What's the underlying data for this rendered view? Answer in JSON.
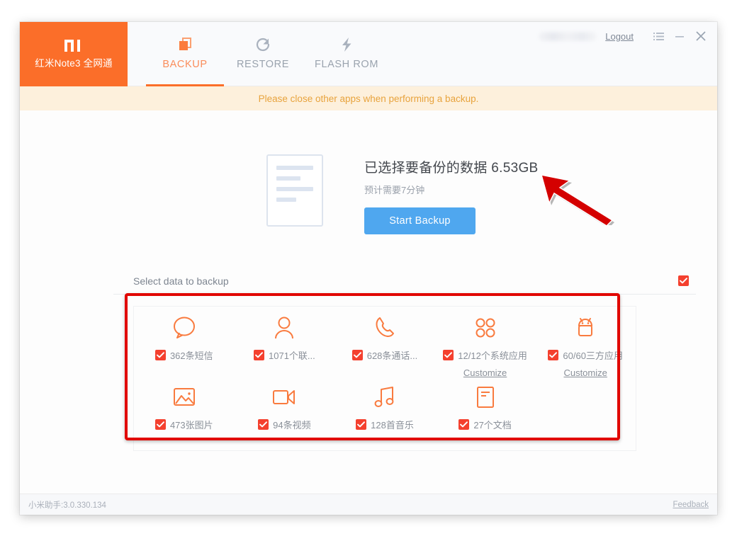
{
  "window": {
    "brand": {
      "logo_icon": "mi-logo-icon",
      "device_name": "红米Note3 全网通"
    },
    "tabs": [
      {
        "label": "BACKUP",
        "icon": "backup-icon",
        "active": true
      },
      {
        "label": "RESTORE",
        "icon": "restore-icon",
        "active": false
      },
      {
        "label": "FLASH ROM",
        "icon": "flash-rom-icon",
        "active": false
      }
    ],
    "account": {
      "username_masked": "",
      "logout_label": "Logout"
    },
    "controls": [
      {
        "name": "menu-icon",
        "glyph": "≔"
      },
      {
        "name": "minimize-icon",
        "glyph": "–"
      },
      {
        "name": "close-icon",
        "glyph": "✕"
      }
    ]
  },
  "notice": {
    "text": "Please close other apps when performing a backup."
  },
  "summary": {
    "illustration_icon": "document-illustration-icon",
    "title": "已选择要备份的数据 6.53GB",
    "size_value": "6.53GB",
    "subtitle": "预计需要7分钟",
    "start_button": "Start Backup",
    "button_color": "#4fa7ef"
  },
  "select_section": {
    "label": "Select data to backup",
    "select_all_checked": true,
    "checkbox_color": "#f4402e"
  },
  "items": {
    "row1": [
      {
        "icon": "sms-message-icon",
        "label": "362条短信",
        "checked": true,
        "link": null
      },
      {
        "icon": "contact-person-icon",
        "label": "1071个联...",
        "checked": true,
        "link": null
      },
      {
        "icon": "phone-call-icon",
        "label": "628条通话...",
        "checked": true,
        "link": null
      },
      {
        "icon": "system-apps-grid-icon",
        "label": "12/12个系统应用",
        "checked": true,
        "link": "Customize"
      },
      {
        "icon": "android-robot-icon",
        "label": "60/60三方应用",
        "checked": true,
        "link": "Customize"
      }
    ],
    "row2": [
      {
        "icon": "photo-image-icon",
        "label": "473张图片",
        "checked": true,
        "link": null
      },
      {
        "icon": "video-camera-icon",
        "label": "94条视频",
        "checked": true,
        "link": null
      },
      {
        "icon": "music-note-icon",
        "label": "128首音乐",
        "checked": true,
        "link": null
      },
      {
        "icon": "document-file-icon",
        "label": "27个文档",
        "checked": true,
        "link": null
      }
    ]
  },
  "footer": {
    "version": "小米助手:3.0.330.134",
    "feedback": "Feedback"
  },
  "annotations": {
    "highlight_rect_color": "#e10600",
    "arrow_color": "#d40000"
  }
}
